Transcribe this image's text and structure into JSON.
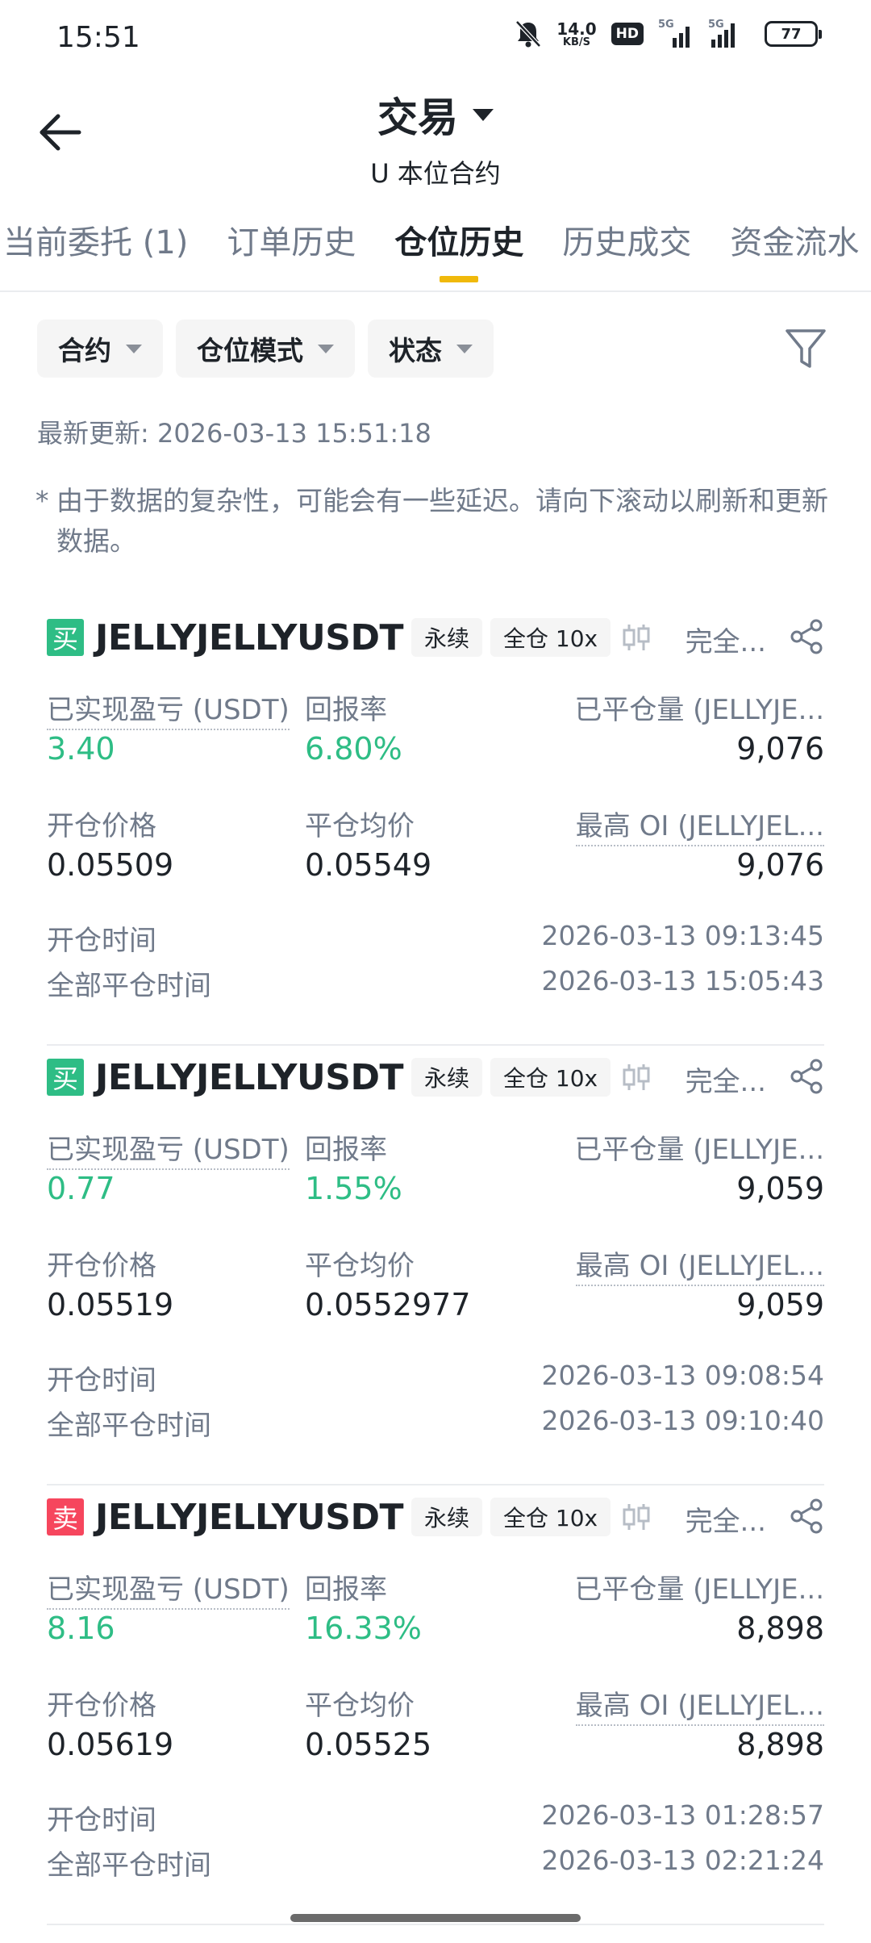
{
  "status_bar": {
    "time": "15:51",
    "net_speed": "14.0",
    "net_speed_unit": "KB/S",
    "hd_label": "HD",
    "signal1_label": "5G",
    "signal2_label": "5G",
    "battery": "77"
  },
  "header": {
    "title": "交易",
    "subtitle": "U 本位合约"
  },
  "tabs": [
    {
      "label": "当前委托 (1)"
    },
    {
      "label": "订单历史"
    },
    {
      "label": "仓位历史"
    },
    {
      "label": "历史成交"
    },
    {
      "label": "资金流水"
    }
  ],
  "active_tab": "仓位历史",
  "filters": [
    {
      "label": "合约"
    },
    {
      "label": "仓位模式"
    },
    {
      "label": "状态"
    }
  ],
  "last_updated": "最新更新: 2026-03-13 15:51:18",
  "note": {
    "star": "*",
    "text": "由于数据的复杂性，可能会有一些延迟。请向下滚动以刷新和更新数据。"
  },
  "labels": {
    "realized_pnl": "已实现盈亏 (USDT)",
    "roi": "回报率",
    "closed_qty": "已平仓量 (JELLYJE...",
    "entry_price": "开仓价格",
    "avg_close_price": "平仓均价",
    "max_oi": "最高 OI (JELLYJEL...",
    "open_time": "开仓时间",
    "full_close_time": "全部平仓时间"
  },
  "colors": {
    "buy": "#2ebd85",
    "sell": "#f6465d",
    "accent": "#f0b90b"
  },
  "positions": [
    {
      "side": "买",
      "side_type": "buy",
      "symbol": "JELLYJELLYUSDT",
      "tag_perpetual": "永续",
      "tag_margin": "全仓 10x",
      "status": "完全...",
      "realized_pnl": "3.40",
      "roi": "6.80%",
      "closed_qty": "9,076",
      "entry_price": "0.05509",
      "avg_close_price": "0.05549",
      "max_oi": "9,076",
      "open_time": "2026-03-13 09:13:45",
      "close_time": "2026-03-13 15:05:43"
    },
    {
      "side": "买",
      "side_type": "buy",
      "symbol": "JELLYJELLYUSDT",
      "tag_perpetual": "永续",
      "tag_margin": "全仓 10x",
      "status": "完全...",
      "realized_pnl": "0.77",
      "roi": "1.55%",
      "closed_qty": "9,059",
      "entry_price": "0.05519",
      "avg_close_price": "0.0552977",
      "max_oi": "9,059",
      "open_time": "2026-03-13 09:08:54",
      "close_time": "2026-03-13 09:10:40"
    },
    {
      "side": "卖",
      "side_type": "sell",
      "symbol": "JELLYJELLYUSDT",
      "tag_perpetual": "永续",
      "tag_margin": "全仓 10x",
      "status": "完全...",
      "realized_pnl": "8.16",
      "roi": "16.33%",
      "closed_qty": "8,898",
      "entry_price": "0.05619",
      "avg_close_price": "0.05525",
      "max_oi": "8,898",
      "open_time": "2026-03-13 01:28:57",
      "close_time": "2026-03-13 02:21:24"
    }
  ]
}
